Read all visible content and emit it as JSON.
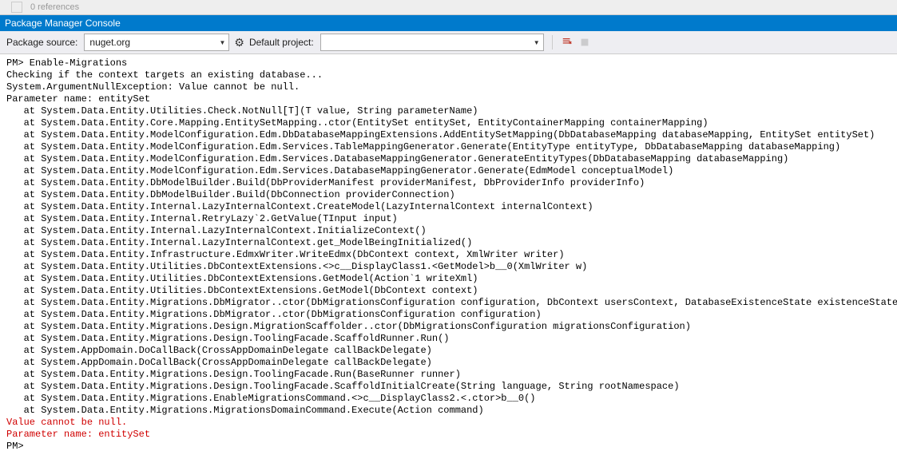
{
  "header": {
    "references_text": "0 references",
    "title": "Package Manager Console"
  },
  "toolbar": {
    "pkg_source_label": "Package source:",
    "pkg_source_value": "nuget.org",
    "default_project_label": "Default project:",
    "default_project_value": ""
  },
  "console": {
    "prompt": "PM>",
    "command": "Enable-Migrations",
    "lines": [
      "Checking if the context targets an existing database...",
      "System.ArgumentNullException: Value cannot be null.",
      "Parameter name: entitySet",
      "   at System.Data.Entity.Utilities.Check.NotNull[T](T value, String parameterName)",
      "   at System.Data.Entity.Core.Mapping.EntitySetMapping..ctor(EntitySet entitySet, EntityContainerMapping containerMapping)",
      "   at System.Data.Entity.ModelConfiguration.Edm.DbDatabaseMappingExtensions.AddEntitySetMapping(DbDatabaseMapping databaseMapping, EntitySet entitySet)",
      "   at System.Data.Entity.ModelConfiguration.Edm.Services.TableMappingGenerator.Generate(EntityType entityType, DbDatabaseMapping databaseMapping)",
      "   at System.Data.Entity.ModelConfiguration.Edm.Services.DatabaseMappingGenerator.GenerateEntityTypes(DbDatabaseMapping databaseMapping)",
      "   at System.Data.Entity.ModelConfiguration.Edm.Services.DatabaseMappingGenerator.Generate(EdmModel conceptualModel)",
      "   at System.Data.Entity.DbModelBuilder.Build(DbProviderManifest providerManifest, DbProviderInfo providerInfo)",
      "   at System.Data.Entity.DbModelBuilder.Build(DbConnection providerConnection)",
      "   at System.Data.Entity.Internal.LazyInternalContext.CreateModel(LazyInternalContext internalContext)",
      "   at System.Data.Entity.Internal.RetryLazy`2.GetValue(TInput input)",
      "   at System.Data.Entity.Internal.LazyInternalContext.InitializeContext()",
      "   at System.Data.Entity.Internal.LazyInternalContext.get_ModelBeingInitialized()",
      "   at System.Data.Entity.Infrastructure.EdmxWriter.WriteEdmx(DbContext context, XmlWriter writer)",
      "   at System.Data.Entity.Utilities.DbContextExtensions.<>c__DisplayClass1.<GetModel>b__0(XmlWriter w)",
      "   at System.Data.Entity.Utilities.DbContextExtensions.GetModel(Action`1 writeXml)",
      "   at System.Data.Entity.Utilities.DbContextExtensions.GetModel(DbContext context)",
      "   at System.Data.Entity.Migrations.DbMigrator..ctor(DbMigrationsConfiguration configuration, DbContext usersContext, DatabaseExistenceState existenceState)",
      "   at System.Data.Entity.Migrations.DbMigrator..ctor(DbMigrationsConfiguration configuration)",
      "   at System.Data.Entity.Migrations.Design.MigrationScaffolder..ctor(DbMigrationsConfiguration migrationsConfiguration)",
      "   at System.Data.Entity.Migrations.Design.ToolingFacade.ScaffoldRunner.Run()",
      "   at System.AppDomain.DoCallBack(CrossAppDomainDelegate callBackDelegate)",
      "   at System.AppDomain.DoCallBack(CrossAppDomainDelegate callBackDelegate)",
      "   at System.Data.Entity.Migrations.Design.ToolingFacade.Run(BaseRunner runner)",
      "   at System.Data.Entity.Migrations.Design.ToolingFacade.ScaffoldInitialCreate(String language, String rootNamespace)",
      "   at System.Data.Entity.Migrations.EnableMigrationsCommand.<>c__DisplayClass2.<.ctor>b__0()",
      "   at System.Data.Entity.Migrations.MigrationsDomainCommand.Execute(Action command)"
    ],
    "error_lines": [
      "Value cannot be null.",
      "Parameter name: entitySet"
    ]
  }
}
